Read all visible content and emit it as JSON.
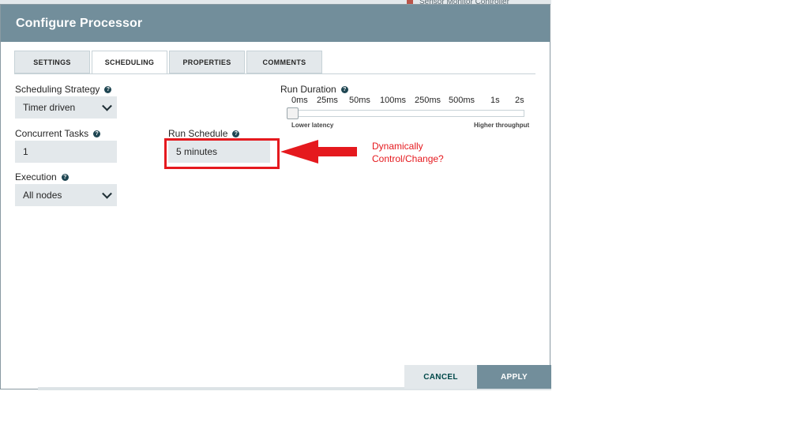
{
  "background": {
    "item_text": "Sensor Monitor Controller"
  },
  "dialog": {
    "title": "Configure Processor"
  },
  "tabs": [
    {
      "label": "SETTINGS"
    },
    {
      "label": "SCHEDULING",
      "active": true
    },
    {
      "label": "PROPERTIES"
    },
    {
      "label": "COMMENTS"
    }
  ],
  "scheduling_strategy": {
    "label": "Scheduling Strategy",
    "value": "Timer driven"
  },
  "concurrent_tasks": {
    "label": "Concurrent Tasks",
    "value": "1"
  },
  "execution": {
    "label": "Execution",
    "value": "All nodes"
  },
  "run_schedule": {
    "label": "Run Schedule",
    "value": "5 minutes"
  },
  "run_duration": {
    "label": "Run Duration",
    "ticks": [
      "0ms",
      "25ms",
      "50ms",
      "100ms",
      "250ms",
      "500ms",
      "1s",
      "2s"
    ],
    "selected_tick": "0ms",
    "low_label": "Lower latency",
    "high_label": "Higher throughput"
  },
  "annotation": {
    "line1": "Dynamically",
    "line2": "Control/Change?",
    "color": "#e5191e"
  },
  "buttons": {
    "cancel": "CANCEL",
    "apply": "APPLY"
  },
  "icons": {
    "help": "help-circle-icon",
    "chevron": "chevron-down-icon",
    "arrow": "red-arrow-left-icon"
  },
  "colors": {
    "header": "#728e9b",
    "field_bg": "#e3e8eb",
    "annotation_red": "#e5191e"
  }
}
